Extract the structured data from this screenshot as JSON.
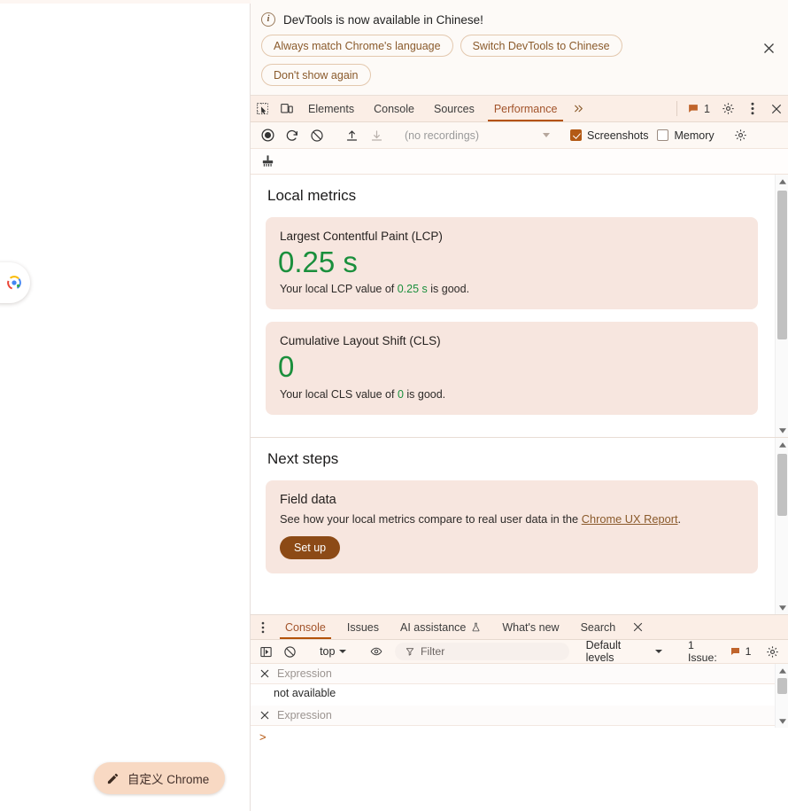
{
  "notification": {
    "message": "DevTools is now available in Chinese!",
    "buttons": [
      "Always match Chrome's language",
      "Switch DevTools to Chinese",
      "Don't show again"
    ],
    "close_label": "Close"
  },
  "main_tabs": {
    "items": [
      "Elements",
      "Console",
      "Sources",
      "Performance"
    ],
    "active": "Performance",
    "overflow_label": "More tabs",
    "issue_count": "1"
  },
  "performance_toolbar": {
    "recordings_placeholder": "(no recordings)",
    "screenshots_label": "Screenshots",
    "screenshots_checked": true,
    "memory_label": "Memory",
    "memory_checked": false
  },
  "local_metrics": {
    "title": "Local metrics",
    "cards": [
      {
        "name": "Largest Contentful Paint (LCP)",
        "value": "0.25 s",
        "desc_prefix": "Your local LCP value of ",
        "desc_value": "0.25 s",
        "desc_suffix": " is good."
      },
      {
        "name": "Cumulative Layout Shift (CLS)",
        "value": "0",
        "desc_prefix": "Your local CLS value of ",
        "desc_value": "0",
        "desc_suffix": " is good."
      }
    ]
  },
  "next_steps": {
    "title": "Next steps",
    "card_title": "Field data",
    "card_body_prefix": "See how your local metrics compare to real user data in the ",
    "card_link": "Chrome UX Report",
    "card_body_suffix": ".",
    "button": "Set up"
  },
  "drawer": {
    "tabs": [
      "Console",
      "Issues",
      "AI assistance",
      "What's new",
      "Search"
    ],
    "active": "Console",
    "console_toolbar": {
      "context": "top",
      "filter_placeholder": "Filter",
      "levels": "Default levels",
      "issue_text": "1 Issue:",
      "issue_count": "1"
    },
    "console_entries": [
      {
        "placeholder": "Expression",
        "value": "not available"
      },
      {
        "placeholder": "Expression",
        "value": ""
      }
    ],
    "prompt": ">"
  },
  "page": {
    "customize_chrome": "自定义 Chrome"
  },
  "colors": {
    "accent": "#b45309",
    "good": "#1a8f3c",
    "card_bg": "#f7e6df",
    "tabbar_bg": "#fbeee6",
    "button_brown": "#8c4a16"
  }
}
